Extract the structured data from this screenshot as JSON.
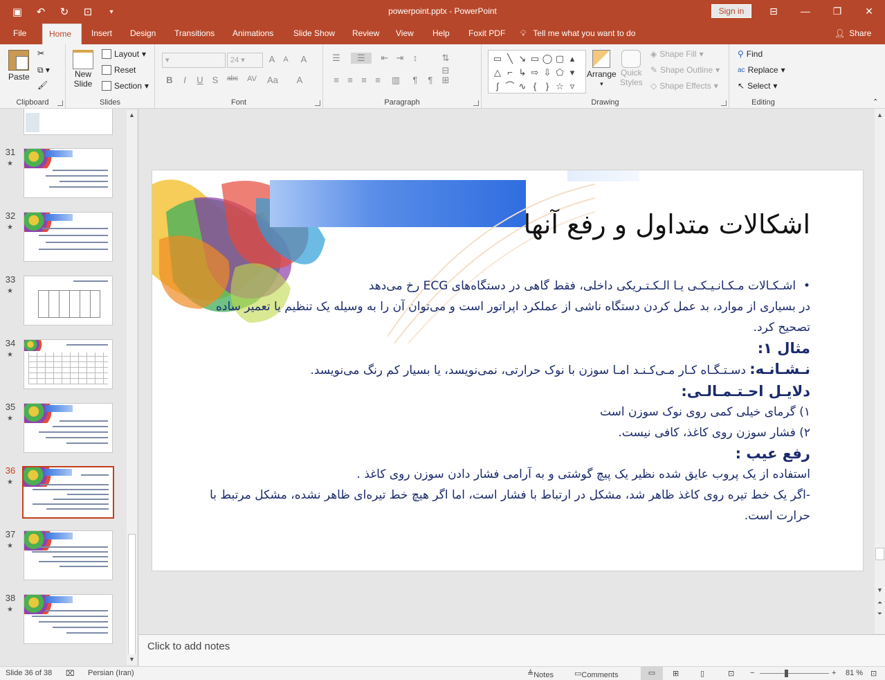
{
  "app": {
    "document_title": "powerpoint.pptx  -  PowerPoint",
    "signin_label": "Sign in"
  },
  "qat": {
    "save_icon": "save-icon",
    "undo_icon": "undo-icon",
    "redo_icon": "redo-icon",
    "present_icon": "present-icon",
    "customize_icon": "customize-icon"
  },
  "tabs": [
    "File",
    "Home",
    "Insert",
    "Design",
    "Transitions",
    "Animations",
    "Slide Show",
    "Review",
    "View",
    "Help",
    "Foxit PDF"
  ],
  "tell_me": "Tell me what you want to do",
  "share": "Share",
  "ribbon": {
    "clipboard": {
      "label": "Clipboard",
      "paste": "Paste"
    },
    "slides": {
      "label": "Slides",
      "new_slide_1": "New",
      "new_slide_2": "Slide",
      "layout": "Layout",
      "reset": "Reset",
      "section": "Section"
    },
    "font": {
      "label": "Font",
      "size": "24",
      "bold": "B",
      "italic": "I",
      "underline": "U",
      "shadow": "S",
      "strike": "abc",
      "spacing": "AV",
      "case": "Aa",
      "grow": "A",
      "shrink": "A",
      "clear": "A"
    },
    "paragraph": {
      "label": "Paragraph"
    },
    "drawing": {
      "label": "Drawing",
      "arrange": "Arrange",
      "quick_styles_1": "Quick",
      "quick_styles_2": "Styles",
      "shape_fill": "Shape Fill",
      "shape_outline": "Shape Outline",
      "shape_effects": "Shape Effects"
    },
    "editing": {
      "label": "Editing",
      "find": "Find",
      "replace": "Replace",
      "select": "Select"
    }
  },
  "thumbnails": [
    {
      "num": "31"
    },
    {
      "num": "32"
    },
    {
      "num": "33"
    },
    {
      "num": "34"
    },
    {
      "num": "35"
    },
    {
      "num": "36"
    },
    {
      "num": "37"
    },
    {
      "num": "38"
    }
  ],
  "slide": {
    "title": "اشکالات متداول و رفع آنها",
    "bullet_line1": "اشـکـالات مـکـانـیـکـی یـا الـکـتـریکی داخلی، فقط گاهی   در دستگاه‌های  ECG رخ می‌دهد",
    "line2": "در بسیاری از موارد، بد عمل کردن دستگاه  ناشی از عملکرد   اپراتور است و می‌توان آن را به وسیله یک تنظیم یا تعمیر ساده تصحیح کرد.",
    "example": "مثال ۱:",
    "sign_label": "نـشـانـه:",
    "sign_text": " دسـتـگـاه کـار مـی‌کـنـد امـا سوزن با نوک حرارتی، نمی‌نویسد، یا بسیار  کم رنگ می‌نویسد.",
    "causes": "دلایـل احـتـمـالـی:",
    "cause1": "۱) گرمای خیلی کمی روی نوک سوزن است",
    "cause2": "۲) فشار سوزن روی کاغذ، کافی نیست.",
    "fix": "رفع عیب :",
    "fix1": "استفاده از یک پروب عایق شده نظیر یک پیچ گوشتی و به آرامی فشار دادن سوزن روی کاغذ  .",
    "fix2": "-اگر یک خط تیره روی کاغذ ظاهر شد، مشکل  در ارتباط با  فشار است، اما اگر هیچ خط تیره‌ای ظاهر نشده، مشکل  مرتبط با حرارت است."
  },
  "notes_placeholder": "Click to add notes",
  "status": {
    "slide_info": "Slide 36 of 38",
    "language": "Persian (Iran)",
    "notes": "Notes",
    "comments": "Comments",
    "zoom": "81 %"
  }
}
